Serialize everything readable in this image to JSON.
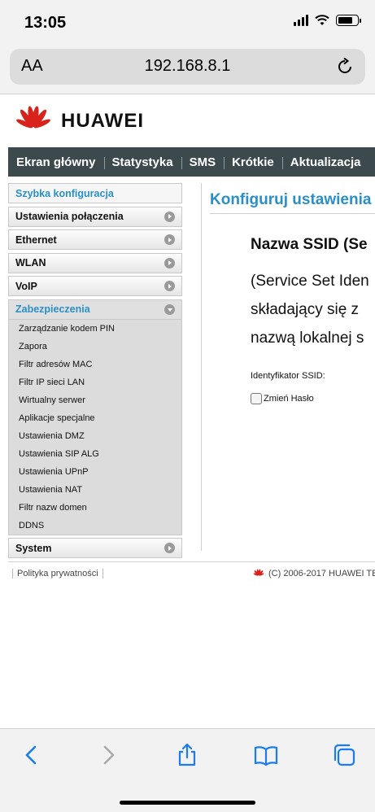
{
  "status_bar": {
    "time": "13:05"
  },
  "browser": {
    "text_size_label": "AA",
    "url": "192.168.8.1"
  },
  "brand": {
    "logo_text": "HUAWEI"
  },
  "nav": {
    "items": [
      "Ekran główny",
      "Statystyka",
      "SMS",
      "Krótkie",
      "Aktualizacja"
    ]
  },
  "sidebar": {
    "quick": "Szybka konfiguracja",
    "items": [
      "Ustawienia połączenia",
      "Ethernet",
      "WLAN",
      "VoIP"
    ],
    "active": "Zabezpieczenia",
    "submenu": [
      "Zarządzanie kodem PIN",
      "Zapora",
      "Filtr adresów MAC",
      "Filtr IP sieci LAN",
      "Wirtualny serwer",
      "Aplikacje specjalne",
      "Ustawienia DMZ",
      "Ustawienia SIP ALG",
      "Ustawienia UPnP",
      "Ustawienia NAT",
      "Filtr nazw domen",
      "DDNS"
    ],
    "last": "System"
  },
  "content": {
    "title": "Konfiguruj ustawienia",
    "heading": "Nazwa SSID (Se",
    "lines": [
      "(Service Set Iden",
      "składający się z",
      "nazwą lokalnej s"
    ],
    "ssid_label": "Identyfikator SSID:",
    "checkbox_label": "Zmień Hasło"
  },
  "footer": {
    "privacy": "Polityka prywatności",
    "copyright": "(C) 2006-2017 HUAWEI TE"
  },
  "colors": {
    "accent": "#2a8fc8",
    "navbar": "#3c4a4e",
    "toolbar_icon": "#1a7cf0",
    "logo_red": "#d9221c"
  }
}
